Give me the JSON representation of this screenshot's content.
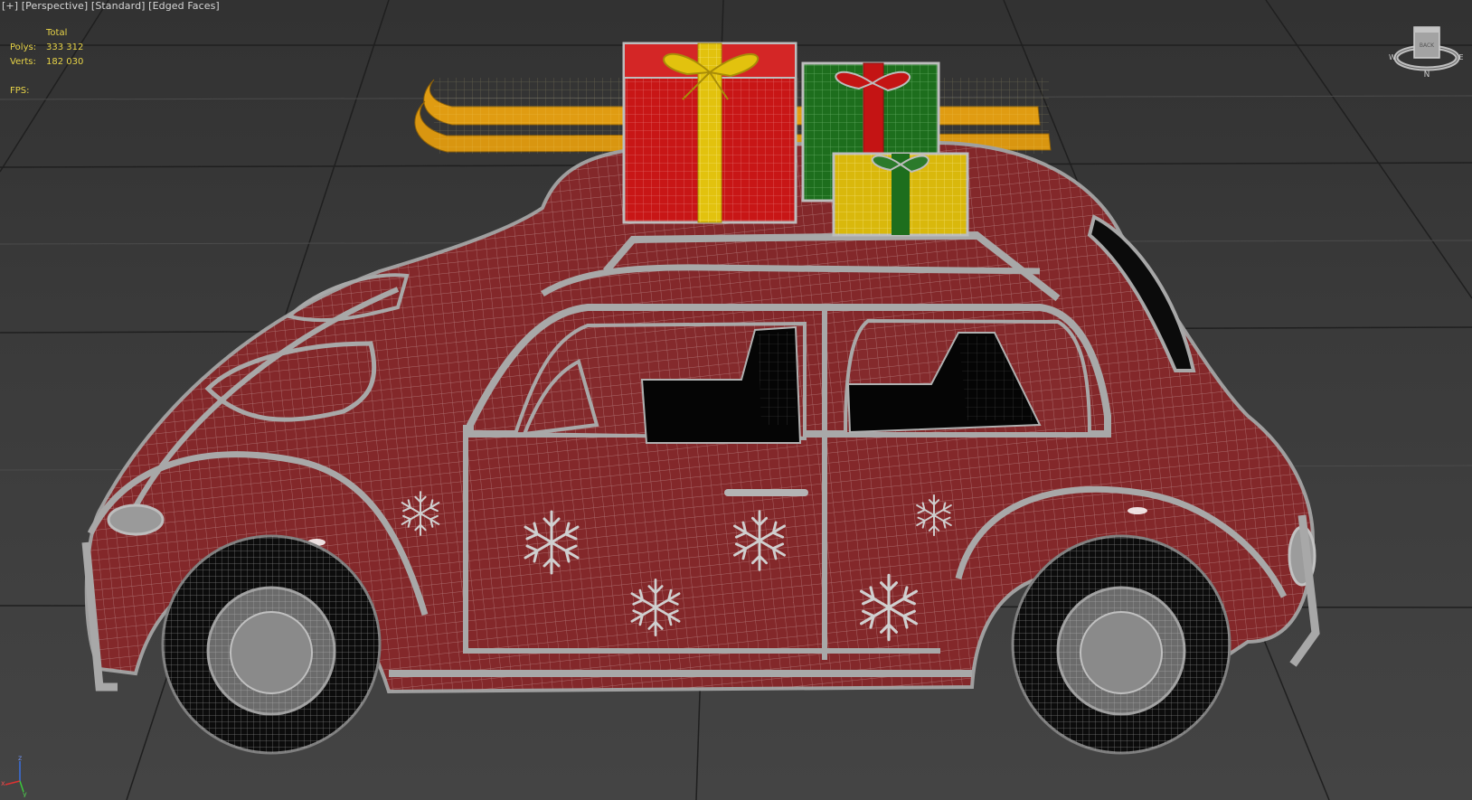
{
  "viewport": {
    "label_parts": [
      "[+]",
      "[Perspective]",
      "[Standard]",
      "[Edged Faces]"
    ]
  },
  "stats": {
    "header": "Total",
    "polys_label": "Polys:",
    "polys_value": "333 312",
    "verts_label": "Verts:",
    "verts_value": "182 030",
    "fps_label": "FPS:"
  },
  "viewcube": {
    "face_label": "BACK",
    "compass_n": "N",
    "compass_e": "E",
    "compass_w": "W"
  },
  "axis_gizmo": {
    "x": "x",
    "y": "y",
    "z": "z"
  },
  "colors": {
    "background": "#3a3a3a",
    "car_body": "#862a2a",
    "wire": "#c7a3a3",
    "gift_red": "#c41414",
    "gift_green": "#1f6e1f",
    "gift_yellow": "#d8b60c",
    "ski": "#e0a010",
    "stats_text": "#e8d448"
  }
}
